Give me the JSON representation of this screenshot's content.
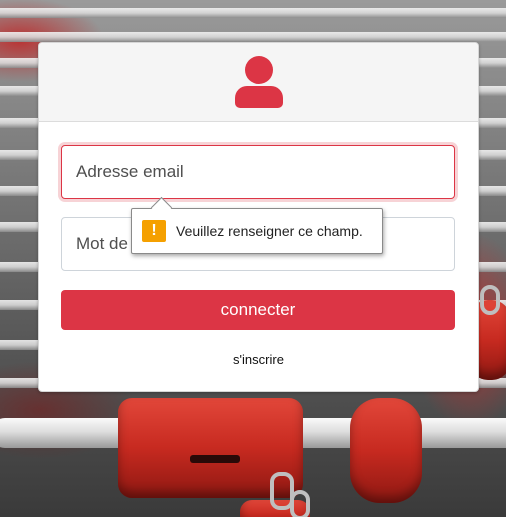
{
  "form": {
    "email_placeholder": "Adresse email",
    "password_placeholder": "Mot de passe",
    "submit_label": "connecter",
    "signup_label": "s'inscrire"
  },
  "validation_tooltip": {
    "message": "Veuillez renseigner ce champ.",
    "icon": "warning-icon"
  },
  "colors": {
    "accent": "#dc3545",
    "warning": "#f5a000",
    "header_bg": "#f5f5f5"
  },
  "icons": {
    "header": "user-icon"
  }
}
